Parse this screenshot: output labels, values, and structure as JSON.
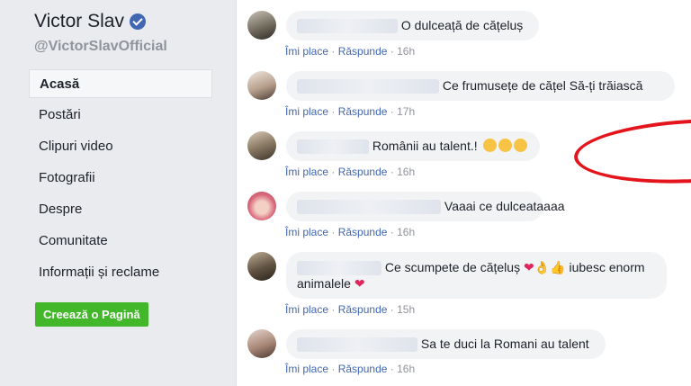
{
  "sidebar": {
    "page_name": "Victor Slav",
    "handle": "@VictorSlavOfficial",
    "items": [
      "Acasă",
      "Postări",
      "Clipuri video",
      "Fotografii",
      "Despre",
      "Comunitate",
      "Informații și reclame"
    ],
    "create_button": "Creează o Pagină"
  },
  "comments": [
    {
      "text": "O dulceață de cățeluș",
      "like": "Îmi place",
      "reply": "Răspunde",
      "time": "16h"
    },
    {
      "text": "Ce frumusețe de cățel Să-ți trăiască",
      "like": "Îmi place",
      "reply": "Răspunde",
      "time": "17h"
    },
    {
      "text": "Românii au talent.!",
      "like": "Îmi place",
      "reply": "Răspunde",
      "time": "16h"
    },
    {
      "text": "Vaaai ce dulceataaaa",
      "like": "Îmi place",
      "reply": "Răspunde",
      "time": "16h"
    },
    {
      "text": "Ce scumpete de cățeluș",
      "text2": "iubesc enorm",
      "text3": "animalele",
      "like": "Îmi place",
      "reply": "Răspunde",
      "time": "15h"
    },
    {
      "text": "Sa te duci la Romani au talent",
      "like": "Îmi place",
      "reply": "Răspunde",
      "time": "16h"
    }
  ],
  "separator": "·",
  "colors": {
    "accent": "#4267b2",
    "verified": "#4267b2",
    "create_button": "#42b72a",
    "highlight_circle": "#e3141c"
  }
}
